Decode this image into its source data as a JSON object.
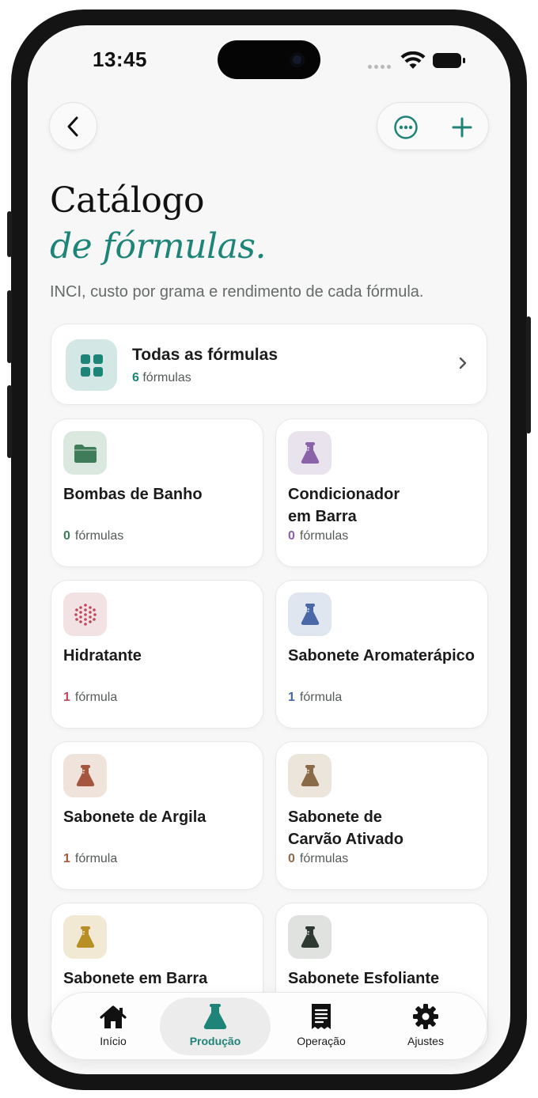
{
  "status_bar": {
    "time": "13:45"
  },
  "header": {
    "title_line1": "Catálogo",
    "title_line2": "de fórmulas.",
    "subtitle": "INCI, custo por grama e rendimento de cada fórmula."
  },
  "all_formulas": {
    "title": "Todas as fórmulas",
    "count": "6",
    "unit": "fórmulas"
  },
  "categories": [
    {
      "name": "Bombas de Banho",
      "count": "0",
      "unit": "fórmulas",
      "icon": "folder-icon",
      "color": "#3f7d5a",
      "bg": "#dbe8df"
    },
    {
      "name": "Condicionador em Barra",
      "count": "0",
      "unit": "fórmulas",
      "icon": "flask-icon",
      "color": "#8a62a8",
      "bg": "#e9e3ee"
    },
    {
      "name": "Hidratante",
      "count": "1",
      "unit": "fórmula",
      "icon": "dots-sphere-icon",
      "color": "#c0485a",
      "bg": "#f2e2e4"
    },
    {
      "name": "Sabonete Aromaterápico",
      "count": "1",
      "unit": "fórmula",
      "icon": "flask-icon",
      "color": "#4a67a8",
      "bg": "#e0e6f0"
    },
    {
      "name": "Sabonete de Argila",
      "count": "1",
      "unit": "fórmula",
      "icon": "flask-icon",
      "color": "#a5563e",
      "bg": "#f0e3dc"
    },
    {
      "name": "Sabonete de Carvão Ativado",
      "count": "0",
      "unit": "fórmulas",
      "icon": "flask-icon",
      "color": "#8a6a48",
      "bg": "#ece5dc"
    },
    {
      "name": "Sabonete em Barra",
      "count": "",
      "unit": "",
      "icon": "flask-icon",
      "color": "#b88f25",
      "bg": "#f1e9d4"
    },
    {
      "name": "Sabonete Esfoliante",
      "count": "",
      "unit": "",
      "icon": "flask-icon",
      "color": "#2f3a33",
      "bg": "#dfe2df"
    }
  ],
  "tabs": [
    {
      "label": "Início",
      "icon": "house-icon"
    },
    {
      "label": "Produção",
      "icon": "flask-icon",
      "active": true
    },
    {
      "label": "Operação",
      "icon": "receipt-icon"
    },
    {
      "label": "Ajustes",
      "icon": "gear-icon"
    }
  ],
  "colors": {
    "accent": "#1e8478",
    "background": "#f6f7f6"
  }
}
